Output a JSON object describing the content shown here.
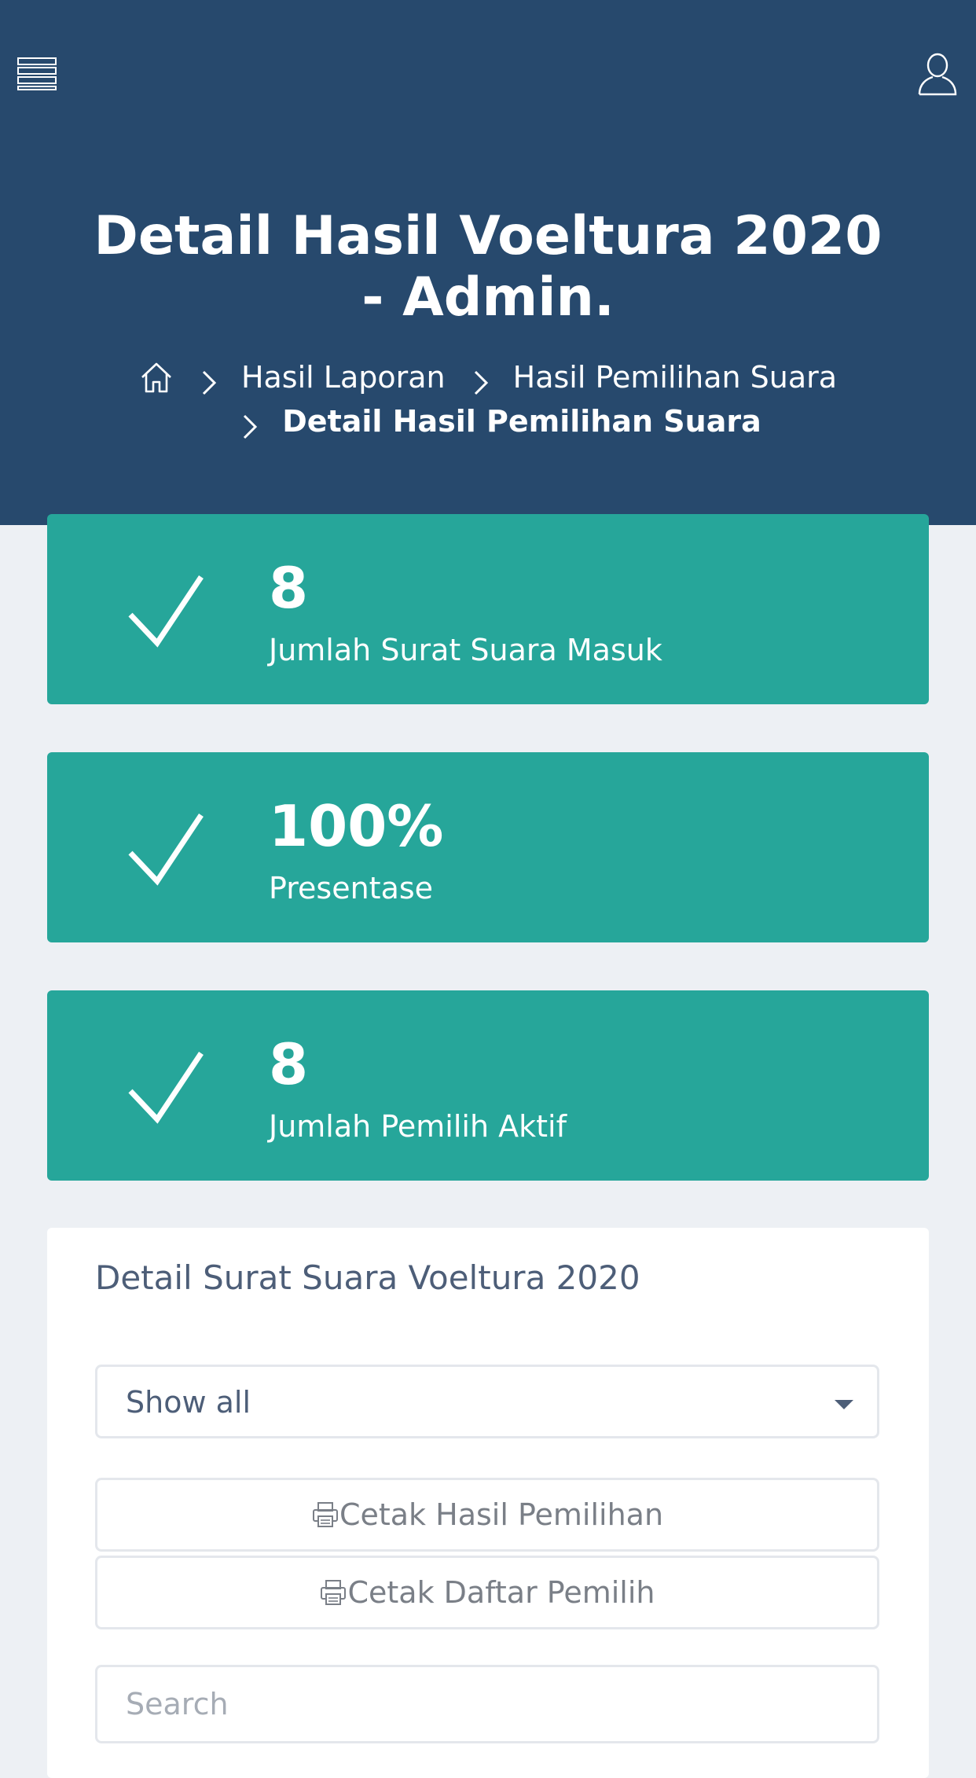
{
  "header": {
    "title": "Detail Hasil Voeltura 2020 - Admin.",
    "menu_icon": "hamburger-menu-icon",
    "user_icon": "user-icon",
    "background_color": "#27496d"
  },
  "breadcrumb": {
    "home_icon": "home-icon",
    "items": [
      {
        "label": "Hasil Laporan"
      },
      {
        "label": "Hasil Pemilihan Suara"
      },
      {
        "label": "Detail Hasil Pemilihan Suara"
      }
    ]
  },
  "stats": [
    {
      "value": "8",
      "label": "Jumlah Surat Suara Masuk",
      "icon": "check-icon"
    },
    {
      "value": "100%",
      "label": "Presentase",
      "icon": "check-icon"
    },
    {
      "value": "8",
      "label": "Jumlah Pemilih Aktif",
      "icon": "check-icon"
    }
  ],
  "stat_card_color": "#26a69a",
  "panel": {
    "title": "Detail Surat Suara Voeltura 2020",
    "filter": {
      "selected": "Show all"
    },
    "buttons": {
      "print_results": "Cetak Hasil Pemilihan",
      "print_voters": "Cetak Daftar Pemilih"
    },
    "search": {
      "placeholder": "Search",
      "value": ""
    }
  }
}
